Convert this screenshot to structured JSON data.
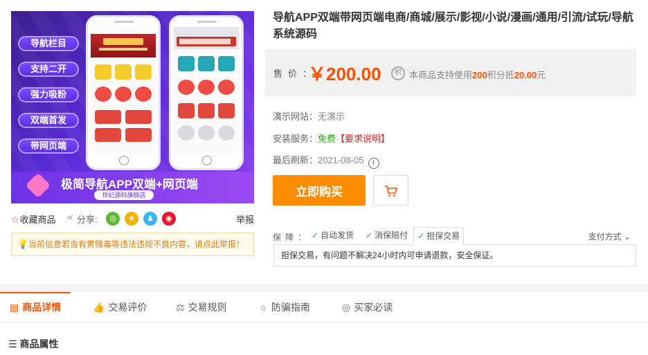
{
  "product_image": {
    "pills": [
      "导航栏目",
      "支持二开",
      "强力吸粉",
      "双端首发",
      "带网页端"
    ],
    "banner_title": "极简导航APP双端+网页端",
    "banner_sub": "世纪源码旗舰店"
  },
  "actions": {
    "favorite_label": "收藏商品",
    "share_label": "分享:",
    "report_label": "举报"
  },
  "warning_text": "当前信息若含有黄赌毒等违法违规不良内容，请点此举报！",
  "product": {
    "title": "导航APP双端带网页端电商/商城/展示/影视/小说/漫画/通用/引流/试玩/导航系统源码",
    "price_label": "售价：",
    "price": "￥200.00",
    "points_prefix": "本商品支持使用",
    "points_amount": "200",
    "points_mid": "积分抵",
    "points_value": "20.00",
    "points_suffix": "元"
  },
  "info": {
    "demo_label": "演示网站：",
    "demo_value": "无演示",
    "install_label": "安装服务：",
    "install_value": "免费",
    "install_req": "【要求说明】",
    "refresh_label": "最后刷新：",
    "refresh_value": "2021-08-05"
  },
  "buy_label": "立即购买",
  "guarantee": {
    "label": "保障：",
    "tabs": [
      "自动发货",
      "消保赔付",
      "担保交易"
    ],
    "active_tab": "担保交易",
    "pay_method": "支付方式",
    "content": "担保交易，有问题不解决24小时内可申请退款，安全保证。"
  },
  "tabs": [
    "商品详情",
    "交易评价",
    "交易规则",
    "防骗指南",
    "买家必读"
  ],
  "section_title": "商品属性",
  "colors": {
    "accent": "#ff5000",
    "buy": "#ff8c00"
  }
}
